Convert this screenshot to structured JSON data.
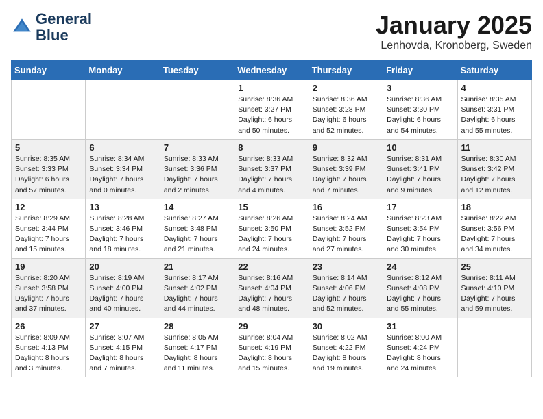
{
  "header": {
    "logo_line1": "General",
    "logo_line2": "Blue",
    "month_title": "January 2025",
    "location": "Lenhovda, Kronoberg, Sweden"
  },
  "days_of_week": [
    "Sunday",
    "Monday",
    "Tuesday",
    "Wednesday",
    "Thursday",
    "Friday",
    "Saturday"
  ],
  "weeks": [
    [
      {
        "day": "",
        "info": ""
      },
      {
        "day": "",
        "info": ""
      },
      {
        "day": "",
        "info": ""
      },
      {
        "day": "1",
        "info": "Sunrise: 8:36 AM\nSunset: 3:27 PM\nDaylight: 6 hours\nand 50 minutes."
      },
      {
        "day": "2",
        "info": "Sunrise: 8:36 AM\nSunset: 3:28 PM\nDaylight: 6 hours\nand 52 minutes."
      },
      {
        "day": "3",
        "info": "Sunrise: 8:36 AM\nSunset: 3:30 PM\nDaylight: 6 hours\nand 54 minutes."
      },
      {
        "day": "4",
        "info": "Sunrise: 8:35 AM\nSunset: 3:31 PM\nDaylight: 6 hours\nand 55 minutes."
      }
    ],
    [
      {
        "day": "5",
        "info": "Sunrise: 8:35 AM\nSunset: 3:33 PM\nDaylight: 6 hours\nand 57 minutes."
      },
      {
        "day": "6",
        "info": "Sunrise: 8:34 AM\nSunset: 3:34 PM\nDaylight: 7 hours\nand 0 minutes."
      },
      {
        "day": "7",
        "info": "Sunrise: 8:33 AM\nSunset: 3:36 PM\nDaylight: 7 hours\nand 2 minutes."
      },
      {
        "day": "8",
        "info": "Sunrise: 8:33 AM\nSunset: 3:37 PM\nDaylight: 7 hours\nand 4 minutes."
      },
      {
        "day": "9",
        "info": "Sunrise: 8:32 AM\nSunset: 3:39 PM\nDaylight: 7 hours\nand 7 minutes."
      },
      {
        "day": "10",
        "info": "Sunrise: 8:31 AM\nSunset: 3:41 PM\nDaylight: 7 hours\nand 9 minutes."
      },
      {
        "day": "11",
        "info": "Sunrise: 8:30 AM\nSunset: 3:42 PM\nDaylight: 7 hours\nand 12 minutes."
      }
    ],
    [
      {
        "day": "12",
        "info": "Sunrise: 8:29 AM\nSunset: 3:44 PM\nDaylight: 7 hours\nand 15 minutes."
      },
      {
        "day": "13",
        "info": "Sunrise: 8:28 AM\nSunset: 3:46 PM\nDaylight: 7 hours\nand 18 minutes."
      },
      {
        "day": "14",
        "info": "Sunrise: 8:27 AM\nSunset: 3:48 PM\nDaylight: 7 hours\nand 21 minutes."
      },
      {
        "day": "15",
        "info": "Sunrise: 8:26 AM\nSunset: 3:50 PM\nDaylight: 7 hours\nand 24 minutes."
      },
      {
        "day": "16",
        "info": "Sunrise: 8:24 AM\nSunset: 3:52 PM\nDaylight: 7 hours\nand 27 minutes."
      },
      {
        "day": "17",
        "info": "Sunrise: 8:23 AM\nSunset: 3:54 PM\nDaylight: 7 hours\nand 30 minutes."
      },
      {
        "day": "18",
        "info": "Sunrise: 8:22 AM\nSunset: 3:56 PM\nDaylight: 7 hours\nand 34 minutes."
      }
    ],
    [
      {
        "day": "19",
        "info": "Sunrise: 8:20 AM\nSunset: 3:58 PM\nDaylight: 7 hours\nand 37 minutes."
      },
      {
        "day": "20",
        "info": "Sunrise: 8:19 AM\nSunset: 4:00 PM\nDaylight: 7 hours\nand 40 minutes."
      },
      {
        "day": "21",
        "info": "Sunrise: 8:17 AM\nSunset: 4:02 PM\nDaylight: 7 hours\nand 44 minutes."
      },
      {
        "day": "22",
        "info": "Sunrise: 8:16 AM\nSunset: 4:04 PM\nDaylight: 7 hours\nand 48 minutes."
      },
      {
        "day": "23",
        "info": "Sunrise: 8:14 AM\nSunset: 4:06 PM\nDaylight: 7 hours\nand 52 minutes."
      },
      {
        "day": "24",
        "info": "Sunrise: 8:12 AM\nSunset: 4:08 PM\nDaylight: 7 hours\nand 55 minutes."
      },
      {
        "day": "25",
        "info": "Sunrise: 8:11 AM\nSunset: 4:10 PM\nDaylight: 7 hours\nand 59 minutes."
      }
    ],
    [
      {
        "day": "26",
        "info": "Sunrise: 8:09 AM\nSunset: 4:13 PM\nDaylight: 8 hours\nand 3 minutes."
      },
      {
        "day": "27",
        "info": "Sunrise: 8:07 AM\nSunset: 4:15 PM\nDaylight: 8 hours\nand 7 minutes."
      },
      {
        "day": "28",
        "info": "Sunrise: 8:05 AM\nSunset: 4:17 PM\nDaylight: 8 hours\nand 11 minutes."
      },
      {
        "day": "29",
        "info": "Sunrise: 8:04 AM\nSunset: 4:19 PM\nDaylight: 8 hours\nand 15 minutes."
      },
      {
        "day": "30",
        "info": "Sunrise: 8:02 AM\nSunset: 4:22 PM\nDaylight: 8 hours\nand 19 minutes."
      },
      {
        "day": "31",
        "info": "Sunrise: 8:00 AM\nSunset: 4:24 PM\nDaylight: 8 hours\nand 24 minutes."
      },
      {
        "day": "",
        "info": ""
      }
    ]
  ]
}
